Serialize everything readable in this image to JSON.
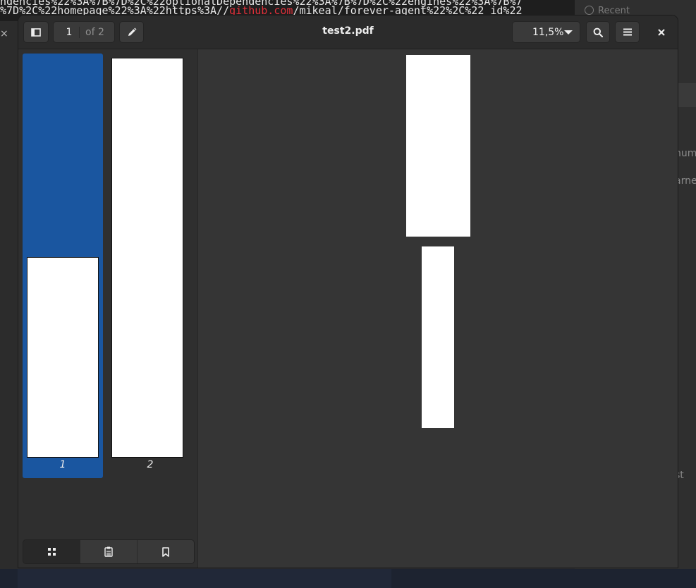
{
  "background": {
    "terminal_line1": "ndencies%22%3A%7B%7D%2C%22optionalDependencies%22%3A%7B%7D%2C%22engines%22%3A%7B%7",
    "terminal_line2_pre": "%7D%2C%22homepage%22%3A%22https%3A//",
    "terminal_line2_hl": "github.com",
    "terminal_line2_post": "/mikeal/forever-agent%22%2C%22_id%22",
    "recent_label": "Recent",
    "right_fragments": [
      "hum",
      "arne",
      "st"
    ],
    "left_close": "×"
  },
  "viewer": {
    "title": "test2.pdf",
    "current_page": "1",
    "page_of": "of 2",
    "zoom": "11,5%",
    "close_glyph": "×"
  },
  "sidebar": {
    "thumbnails": [
      {
        "label": "1",
        "selected": true
      },
      {
        "label": "2",
        "selected": false
      }
    ],
    "view_modes": [
      "thumbnails",
      "outline",
      "bookmarks"
    ],
    "active_view_mode": "thumbnails"
  },
  "colors": {
    "selection": "#1a56a0",
    "window_bg": "#353535",
    "headerbar_bg": "#2b2b2b",
    "highlight_text": "#e0303a"
  }
}
